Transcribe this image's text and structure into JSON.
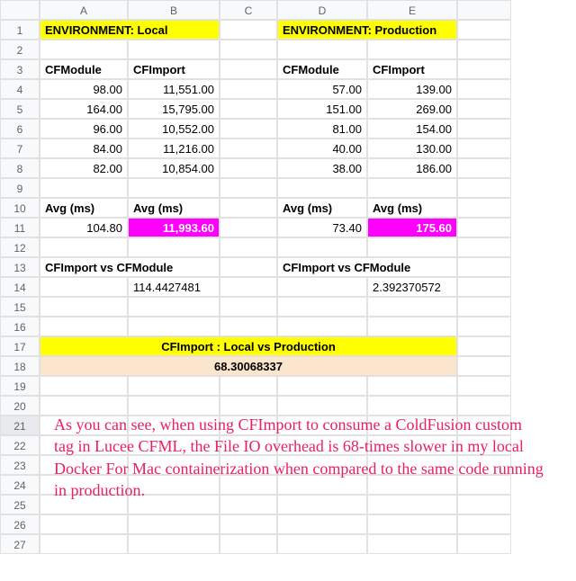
{
  "columns": [
    "A",
    "B",
    "C",
    "D",
    "E",
    ""
  ],
  "rows": [
    "1",
    "2",
    "3",
    "4",
    "5",
    "6",
    "7",
    "8",
    "9",
    "10",
    "11",
    "12",
    "13",
    "14",
    "15",
    "16",
    "17",
    "18",
    "19",
    "20",
    "21",
    "22",
    "23",
    "24",
    "25",
    "26",
    "27"
  ],
  "r1": {
    "a": "ENVIRONMENT: Local",
    "d": "ENVIRONMENT: Production"
  },
  "r3": {
    "a": "CFModule",
    "b": "CFImport",
    "d": "CFModule",
    "e": "CFImport"
  },
  "r4": {
    "a": "98.00",
    "b": "11,551.00",
    "d": "57.00",
    "e": "139.00"
  },
  "r5": {
    "a": "164.00",
    "b": "15,795.00",
    "d": "151.00",
    "e": "269.00"
  },
  "r6": {
    "a": "96.00",
    "b": "10,552.00",
    "d": "81.00",
    "e": "154.00"
  },
  "r7": {
    "a": "84.00",
    "b": "11,216.00",
    "d": "40.00",
    "e": "130.00"
  },
  "r8": {
    "a": "82.00",
    "b": "10,854.00",
    "d": "38.00",
    "e": "186.00"
  },
  "r10": {
    "a": "Avg (ms)",
    "b": "Avg (ms)",
    "d": "Avg (ms)",
    "e": "Avg (ms)"
  },
  "r11": {
    "a": "104.80",
    "b": "11,993.60",
    "d": "73.40",
    "e": "175.60"
  },
  "r13": {
    "a": "CFImport vs CFModule",
    "d": "CFImport vs CFModule"
  },
  "r14": {
    "b": "114.4427481",
    "e": "2.392370572"
  },
  "r17": {
    "title": "CFImport : Local vs Production"
  },
  "r18": {
    "val": "68.30068337"
  },
  "annotation": "As you can see, when using CFImport to consume a ColdFusion custom tag in Lucee CFML, the File IO overhead is 68-times slower in my local Docker For Mac containerization when compared to the same code running in production.",
  "chart_data": {
    "type": "table",
    "title": "CFImport vs CFModule timing comparison (ms)",
    "series": [
      {
        "name": "Local CFModule",
        "values": [
          98,
          164,
          96,
          84,
          82
        ],
        "avg": 104.8
      },
      {
        "name": "Local CFImport",
        "values": [
          11551,
          15795,
          10552,
          11216,
          10854
        ],
        "avg": 11993.6
      },
      {
        "name": "Production CFModule",
        "values": [
          57,
          151,
          81,
          40,
          38
        ],
        "avg": 73.4
      },
      {
        "name": "Production CFImport",
        "values": [
          139,
          269,
          154,
          130,
          186
        ],
        "avg": 175.6
      }
    ],
    "ratios": {
      "local_cfimport_vs_cfmodule": 114.4427481,
      "production_cfimport_vs_cfmodule": 2.392370572,
      "cfimport_local_vs_production": 68.30068337
    }
  }
}
